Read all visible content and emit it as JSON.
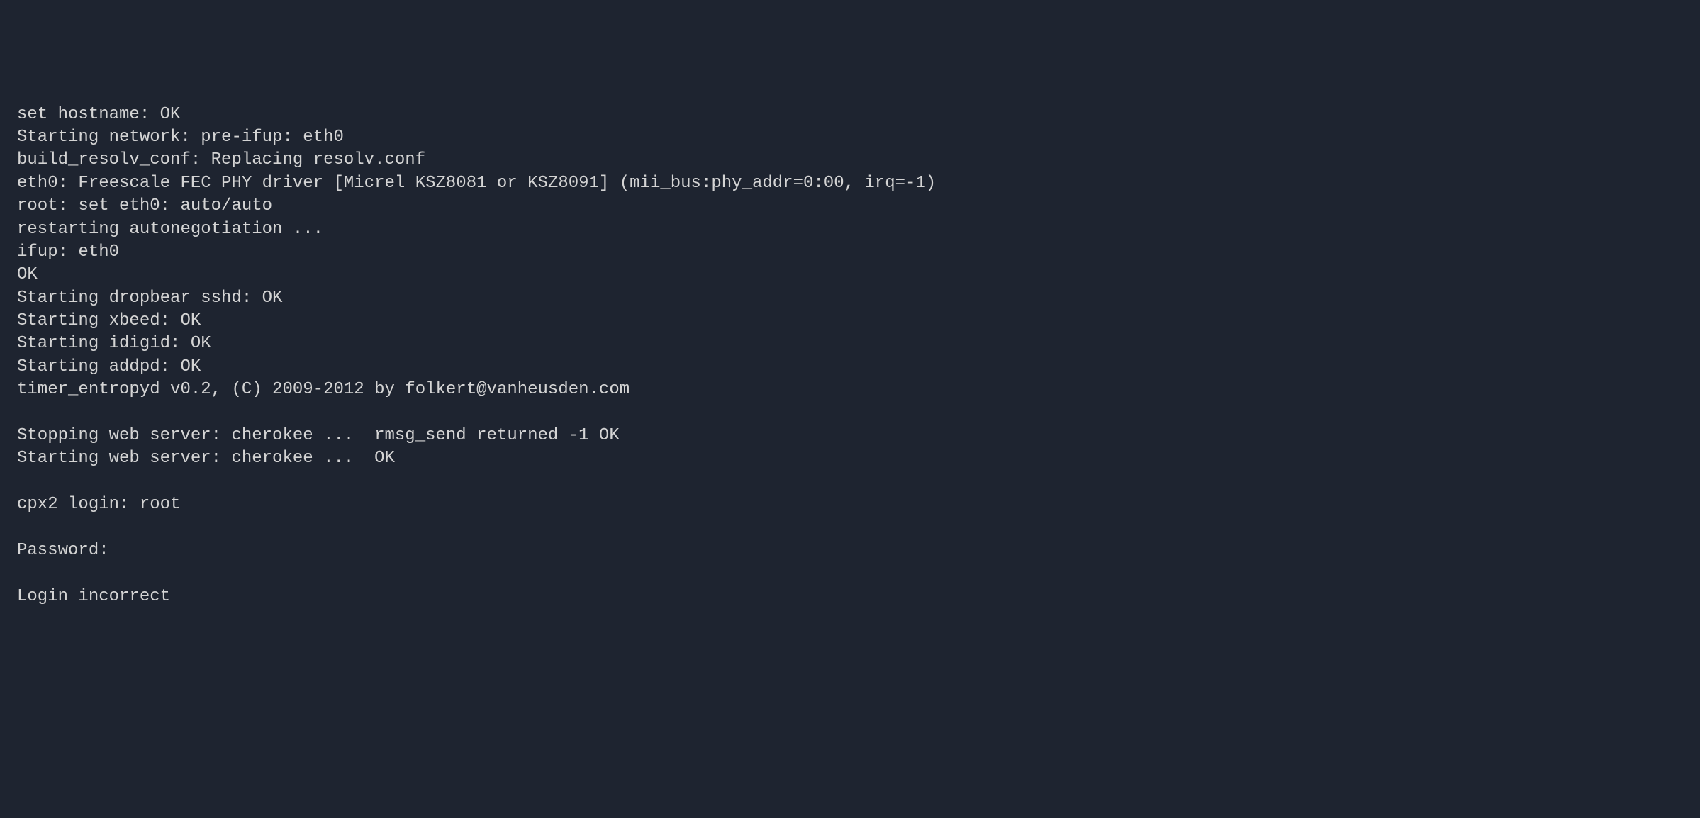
{
  "terminal": {
    "lines": [
      "set hostname: OK",
      "Starting network: pre-ifup: eth0",
      "build_resolv_conf: Replacing resolv.conf",
      "eth0: Freescale FEC PHY driver [Micrel KSZ8081 or KSZ8091] (mii_bus:phy_addr=0:00, irq=-1)",
      "root: set eth0: auto/auto",
      "restarting autonegotiation ...",
      "ifup: eth0",
      "OK",
      "Starting dropbear sshd: OK",
      "Starting xbeed: OK",
      "Starting idigid: OK",
      "Starting addpd: OK",
      "timer_entropyd v0.2, (C) 2009-2012 by folkert@vanheusden.com",
      "",
      "Stopping web server: cherokee ...  rmsg_send returned -1 OK",
      "Starting web server: cherokee ...  OK",
      "",
      "cpx2 login: root",
      "",
      "Password:",
      "",
      "Login incorrect"
    ]
  }
}
